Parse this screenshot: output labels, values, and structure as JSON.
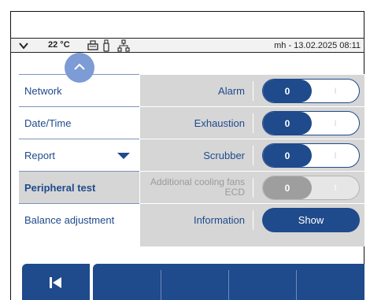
{
  "status_bar": {
    "temperature": "22 °C",
    "user_datetime": "mh - 13.02.2025 08:11",
    "icons": [
      "chevron-down-icon",
      "printer-icon",
      "usb-icon",
      "network-icon"
    ]
  },
  "menu": {
    "items": [
      {
        "label": "Network"
      },
      {
        "label": "Date/Time"
      },
      {
        "label": "Report"
      },
      {
        "label": "Peripheral test"
      },
      {
        "label": "Balance adjustment"
      }
    ],
    "active_index": 3
  },
  "peripheral_tests": [
    {
      "label": "Alarm",
      "toggle_on": "0",
      "toggle_off": "I"
    },
    {
      "label": "Exhaustion",
      "toggle_on": "0",
      "toggle_off": "I"
    },
    {
      "label": "Scrubber",
      "toggle_on": "0",
      "toggle_off": "I"
    },
    {
      "label": "Additional cooling fans ECD",
      "toggle_on": "0",
      "toggle_off": "I",
      "disabled": true
    },
    {
      "label": "Information",
      "button": "Show"
    }
  ],
  "colors": {
    "primary": "#1f4a8c",
    "panel": "#d6d6d6",
    "collapse": "#7d9bd4",
    "disabled": "#9e9e9e"
  }
}
